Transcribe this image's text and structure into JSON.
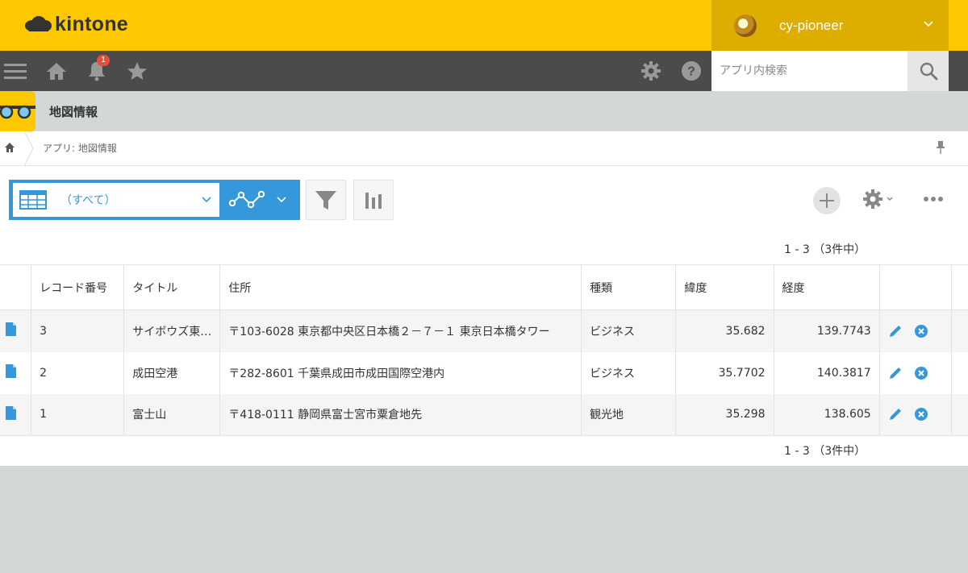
{
  "header": {
    "logo_text": "kintone",
    "user_name": "cy-pioneer",
    "brand_color": "#fcc800"
  },
  "toolbar": {
    "notification_count": "1",
    "search_placeholder": "アプリ内検索"
  },
  "app": {
    "title": "地図情報"
  },
  "breadcrumb": {
    "text": "アプリ: 地図情報"
  },
  "view": {
    "selected": "（すべて）"
  },
  "pager": {
    "top": "1 - 3 （3件中）",
    "bottom": "1 - 3 （3件中）"
  },
  "table": {
    "headers": [
      "レコード番号",
      "タイトル",
      "住所",
      "種類",
      "緯度",
      "経度"
    ],
    "rows": [
      {
        "id": "3",
        "title": "サイボウズ東…",
        "address": "〒103-6028 東京都中央区日本橋２－７－１ 東京日本橋タワー",
        "type": "ビジネス",
        "lat": "35.682",
        "lng": "139.7743"
      },
      {
        "id": "2",
        "title": "成田空港",
        "address": "〒282-8601 千葉県成田市成田国際空港内",
        "type": "ビジネス",
        "lat": "35.7702",
        "lng": "140.3817"
      },
      {
        "id": "1",
        "title": "富士山",
        "address": "〒418-0111 静岡県富士宮市粟倉地先",
        "type": "観光地",
        "lat": "35.298",
        "lng": "138.605"
      }
    ]
  },
  "colors": {
    "accent_blue": "#3498db",
    "toolbar_dark": "#4b4b4b"
  }
}
